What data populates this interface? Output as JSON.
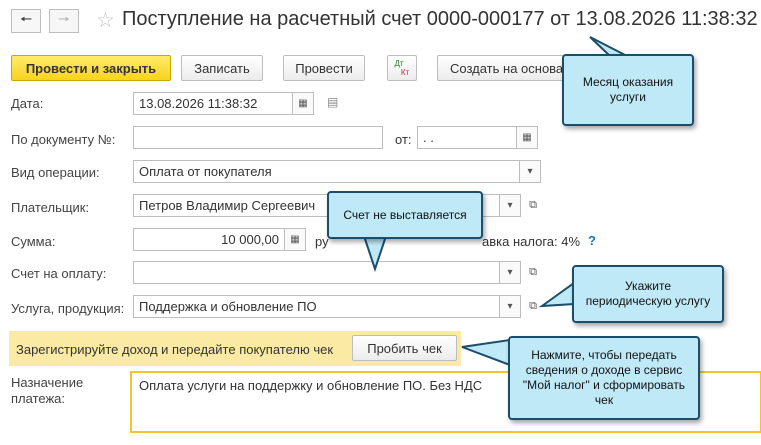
{
  "window": {
    "title": "Поступление на расчетный счет 0000-000177 от 13.08.2026 11:38:32",
    "back_icon": "arrow-left-icon",
    "forward_icon": "arrow-right-icon",
    "star_icon": "star-icon"
  },
  "toolbar": {
    "post_close": "Провести и закрыть",
    "save": "Записать",
    "post": "Провести",
    "dt_label": "Дт",
    "kt_label": "Кт",
    "create_based": "Создать на основании"
  },
  "form": {
    "date": {
      "label": "Дата:",
      "value": "13.08.2026 11:38:32"
    },
    "doc_number": {
      "label": "По документу №:",
      "value": "",
      "from_label": "от:",
      "from_value": " .  ."
    },
    "operation": {
      "label": "Вид операции:",
      "value": "Оплата от покупателя"
    },
    "payer": {
      "label": "Плательщик:",
      "value": "Петров Владимир Сергеевич"
    },
    "amount": {
      "label": "Сумма:",
      "value": "10 000,00",
      "currency_fragment": "ру",
      "tax_rate_text": "авка налога: 4%",
      "help": "?"
    },
    "invoice": {
      "label": "Счет на оплату:",
      "value": ""
    },
    "service": {
      "label": "Услуга, продукция:",
      "value": "Поддержка и обновление ПО"
    },
    "register": {
      "text": "Зарегистрируйте доход и передайте покупателю чек",
      "button": "Пробить чек"
    },
    "purpose": {
      "label_line1": "Назначение",
      "label_line2": "платежа:",
      "value": "Оплата услуги на поддержку и обновление ПО. Без НДС"
    }
  },
  "callouts": {
    "month": "Месяц оказания услуги",
    "no_invoice": "Счет не выставляется",
    "periodic": "Укажите периодическую услугу",
    "press": "Нажмите, чтобы передать сведения о доходе в сервис \"Мой налог\" и сформировать чек"
  }
}
